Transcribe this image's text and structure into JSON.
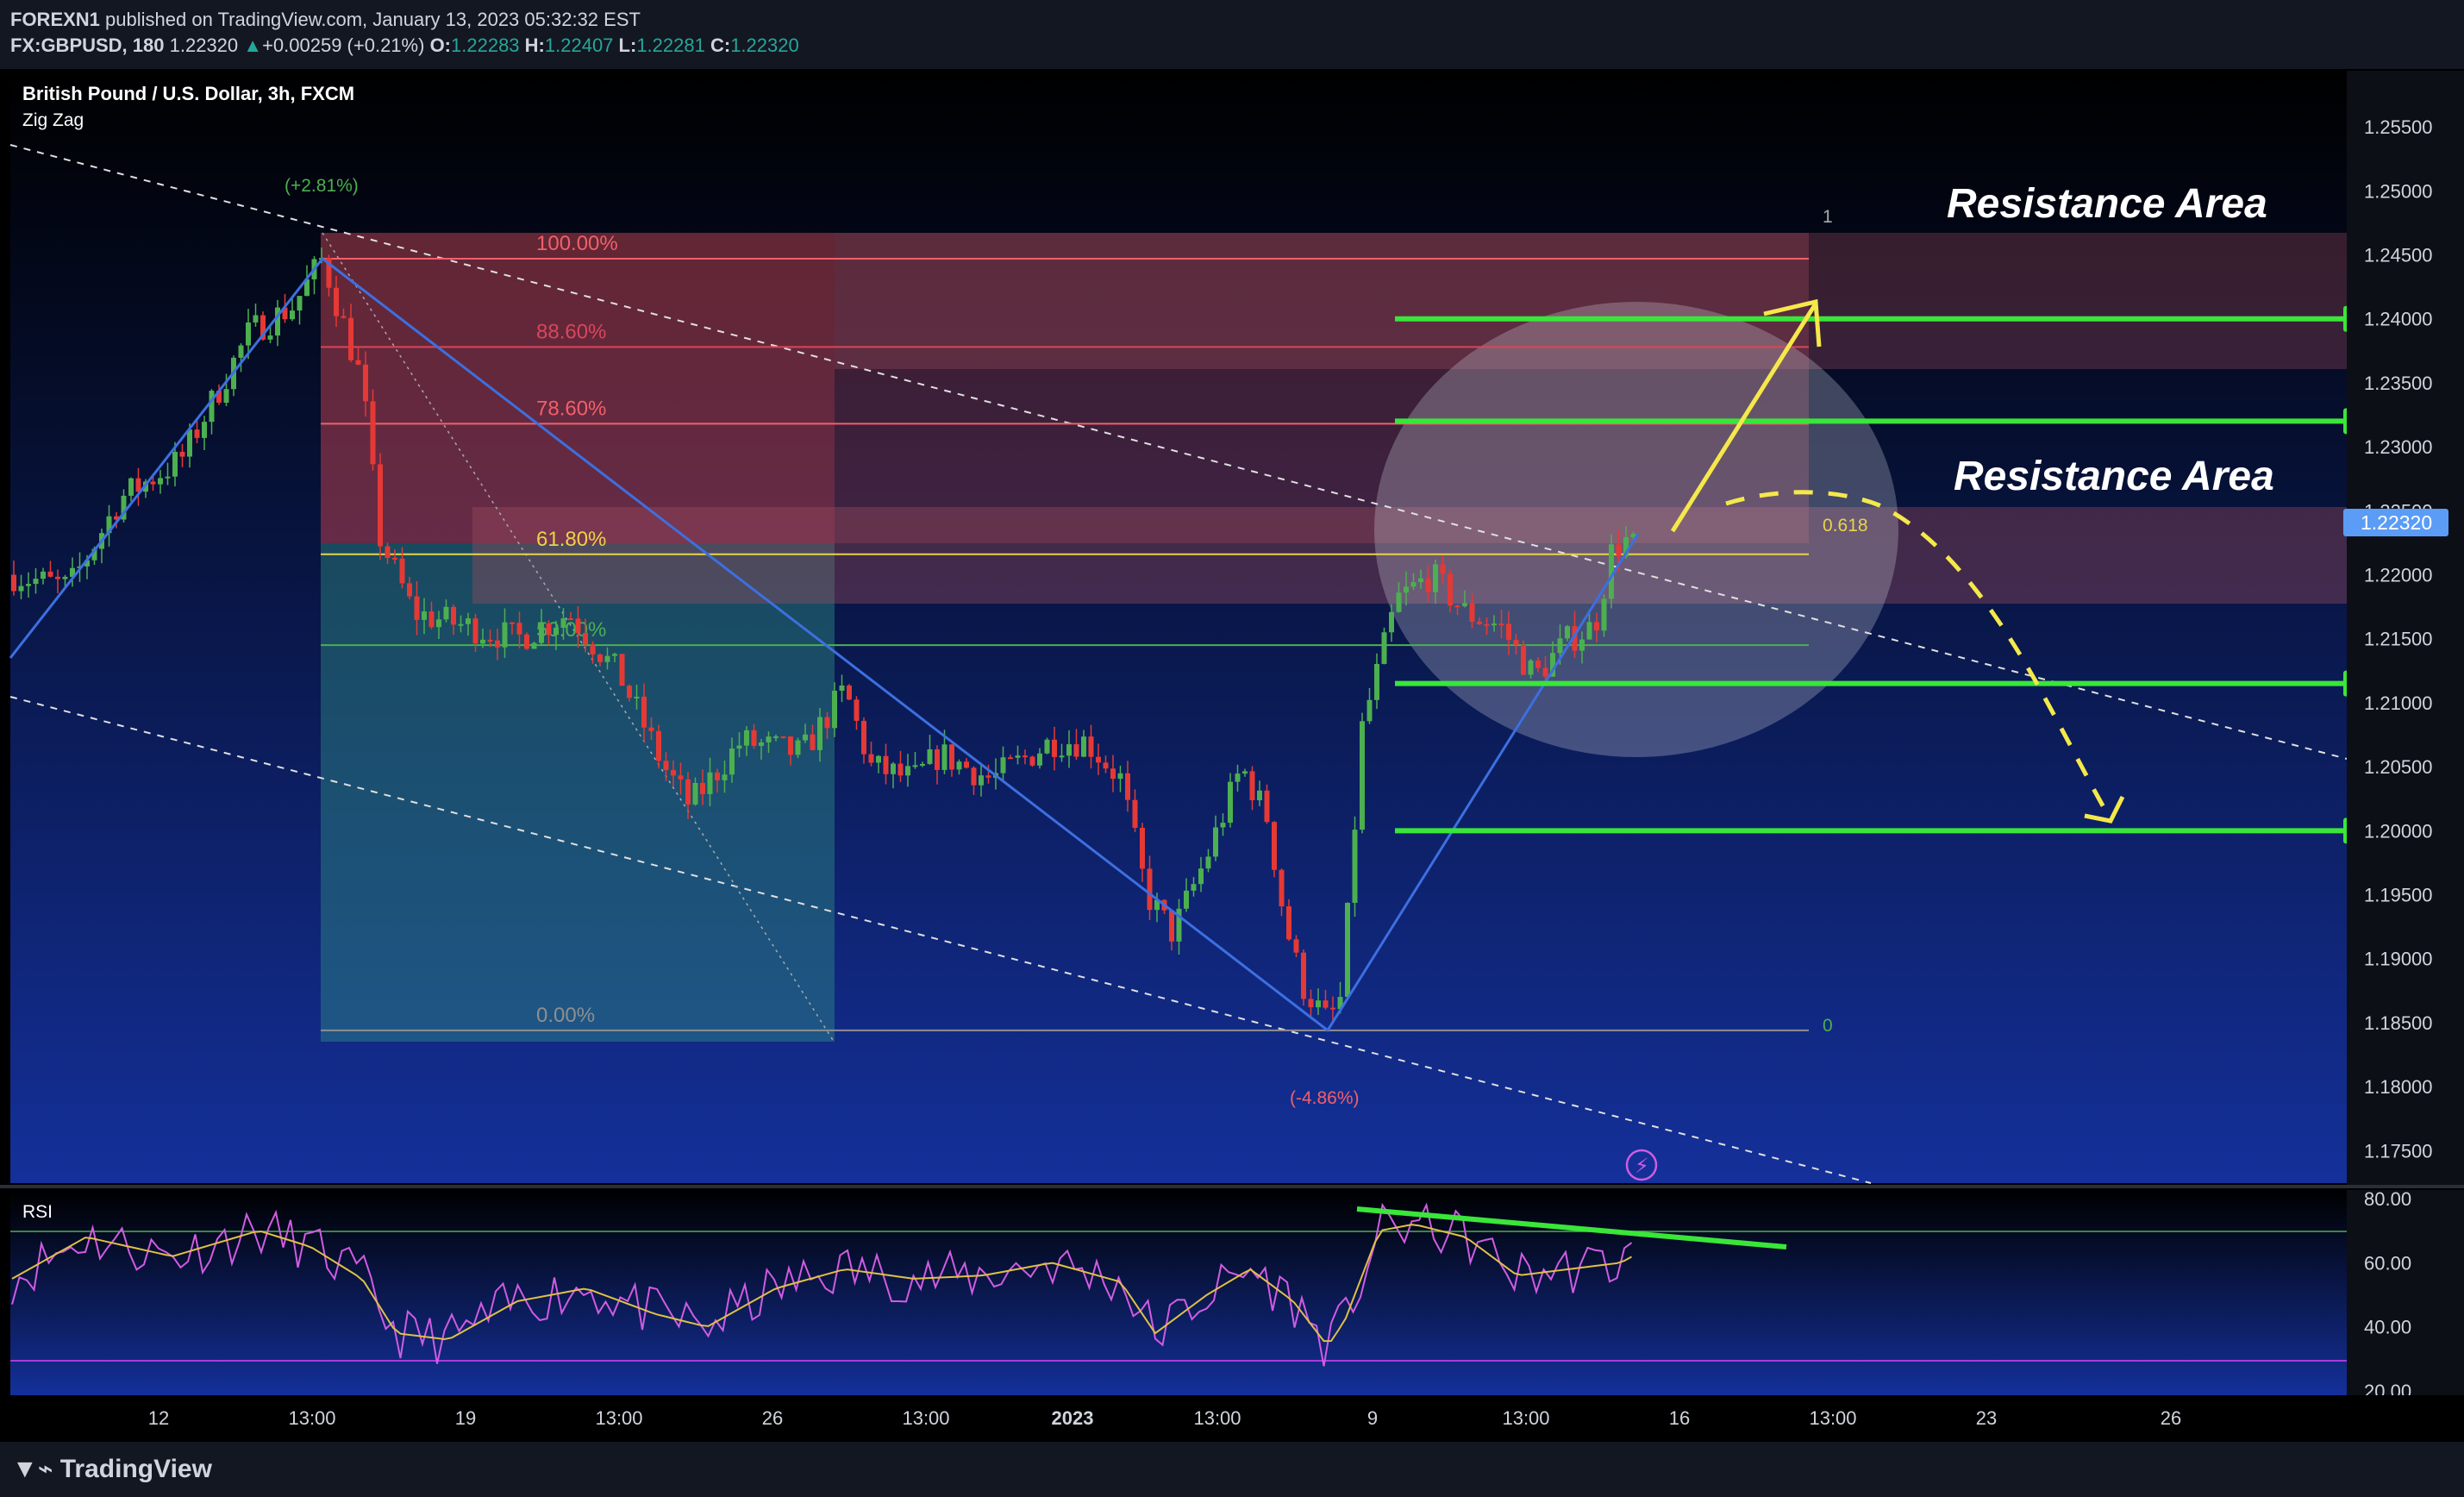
{
  "header": {
    "publisher": "FOREXN1",
    "published_text": " published on TradingView.com, January 13, 2023 05:32:32 EST",
    "symbol": "FX:GBPUSD, 180",
    "last_price": "1.22320",
    "change_arrow": "▲",
    "change": "+0.00259 (+0.21%)",
    "o_label": "O:",
    "o_value": "1.22283",
    "h_label": "H:",
    "h_value": "1.22407",
    "l_label": "L:",
    "l_value": "1.22281",
    "c_label": "C:",
    "c_value": "1.22320"
  },
  "chart_title": "British Pound / U.S. Dollar, 3h, FXCM",
  "indicator_label": "Zig Zag",
  "rsi_label": "RSI",
  "annotations": {
    "resistance_upper": "Resistance Area",
    "resistance_lower": "Resistance Area",
    "zigzag_high_pct": "(+2.81%)",
    "zigzag_low_pct": "(-4.86%)",
    "fib_right_1": "1",
    "fib_right_0618": "0.618",
    "fib_right_0": "0"
  },
  "fib_levels": [
    {
      "label": "100.00%",
      "price": 1.2447,
      "color": "#f0606b"
    },
    {
      "label": "88.60%",
      "price": 1.2378,
      "color": "#d9465a"
    },
    {
      "label": "78.60%",
      "price": 1.2318,
      "color": "#f0606b"
    },
    {
      "label": "61.80%",
      "price": 1.2216,
      "color": "#e6d54a"
    },
    {
      "label": "50.00%",
      "price": 1.2145,
      "color": "#4caf50"
    },
    {
      "label": "0.00%",
      "price": 1.1844,
      "color": "#8f8f8f"
    }
  ],
  "horizontal_levels": [
    {
      "label": "1.24000",
      "price": 1.24
    },
    {
      "label": "1.23200",
      "price": 1.232
    },
    {
      "label": "1.21150",
      "price": 1.2115
    },
    {
      "label": "1.20000",
      "price": 1.2
    }
  ],
  "current_price_label": "1.22320",
  "colors": {
    "bull": "#4caf50",
    "bear": "#e53935",
    "zigzag": "#3d6fe0",
    "level_line": "#39e639",
    "level_tag": "#39e639",
    "price_tag": "#5b9cf6",
    "arrow": "#f5e84a",
    "rsi_line": "#d05ce3",
    "rsi_ma": "#e0c046",
    "rsi_trend": "#39e639"
  },
  "footer": {
    "logo_mark": "▼⌁",
    "logo_text": "TradingView"
  },
  "chart_data": [
    {
      "type": "candlestick",
      "title": "British Pound / U.S. Dollar, 3h, FXCM",
      "ylim": [
        1.173,
        1.2575
      ],
      "y_ticks": [
        "1.25500",
        "1.25000",
        "1.24500",
        "1.24000",
        "1.23500",
        "1.23000",
        "1.22500",
        "1.22000",
        "1.21500",
        "1.21000",
        "1.20500",
        "1.20000",
        "1.19500",
        "1.19000",
        "1.18500",
        "1.18000",
        "1.17500"
      ],
      "x_ticks": [
        "12",
        "13:00",
        "19",
        "13:00",
        "26",
        "13:00",
        "2023",
        "13:00",
        "9",
        "13:00",
        "16",
        "13:00",
        "23",
        "26"
      ],
      "zigzag_path": [
        {
          "x_label": "start",
          "price": 1.2135
        },
        {
          "x_label": "13:00",
          "price": 1.2447
        },
        {
          "x_label": "13:00",
          "price": 1.1844
        },
        {
          "x_label": "9",
          "price": 1.2232
        }
      ],
      "swing_high": 1.2447,
      "swing_low": 1.1844,
      "last_price": 1.2232
    },
    {
      "type": "line",
      "title": "RSI",
      "ylim": [
        20,
        80
      ],
      "y_ticks": [
        "80.00",
        "60.00",
        "40.00",
        "20.00"
      ],
      "bands": [
        70,
        30
      ],
      "last_value": 63
    }
  ]
}
